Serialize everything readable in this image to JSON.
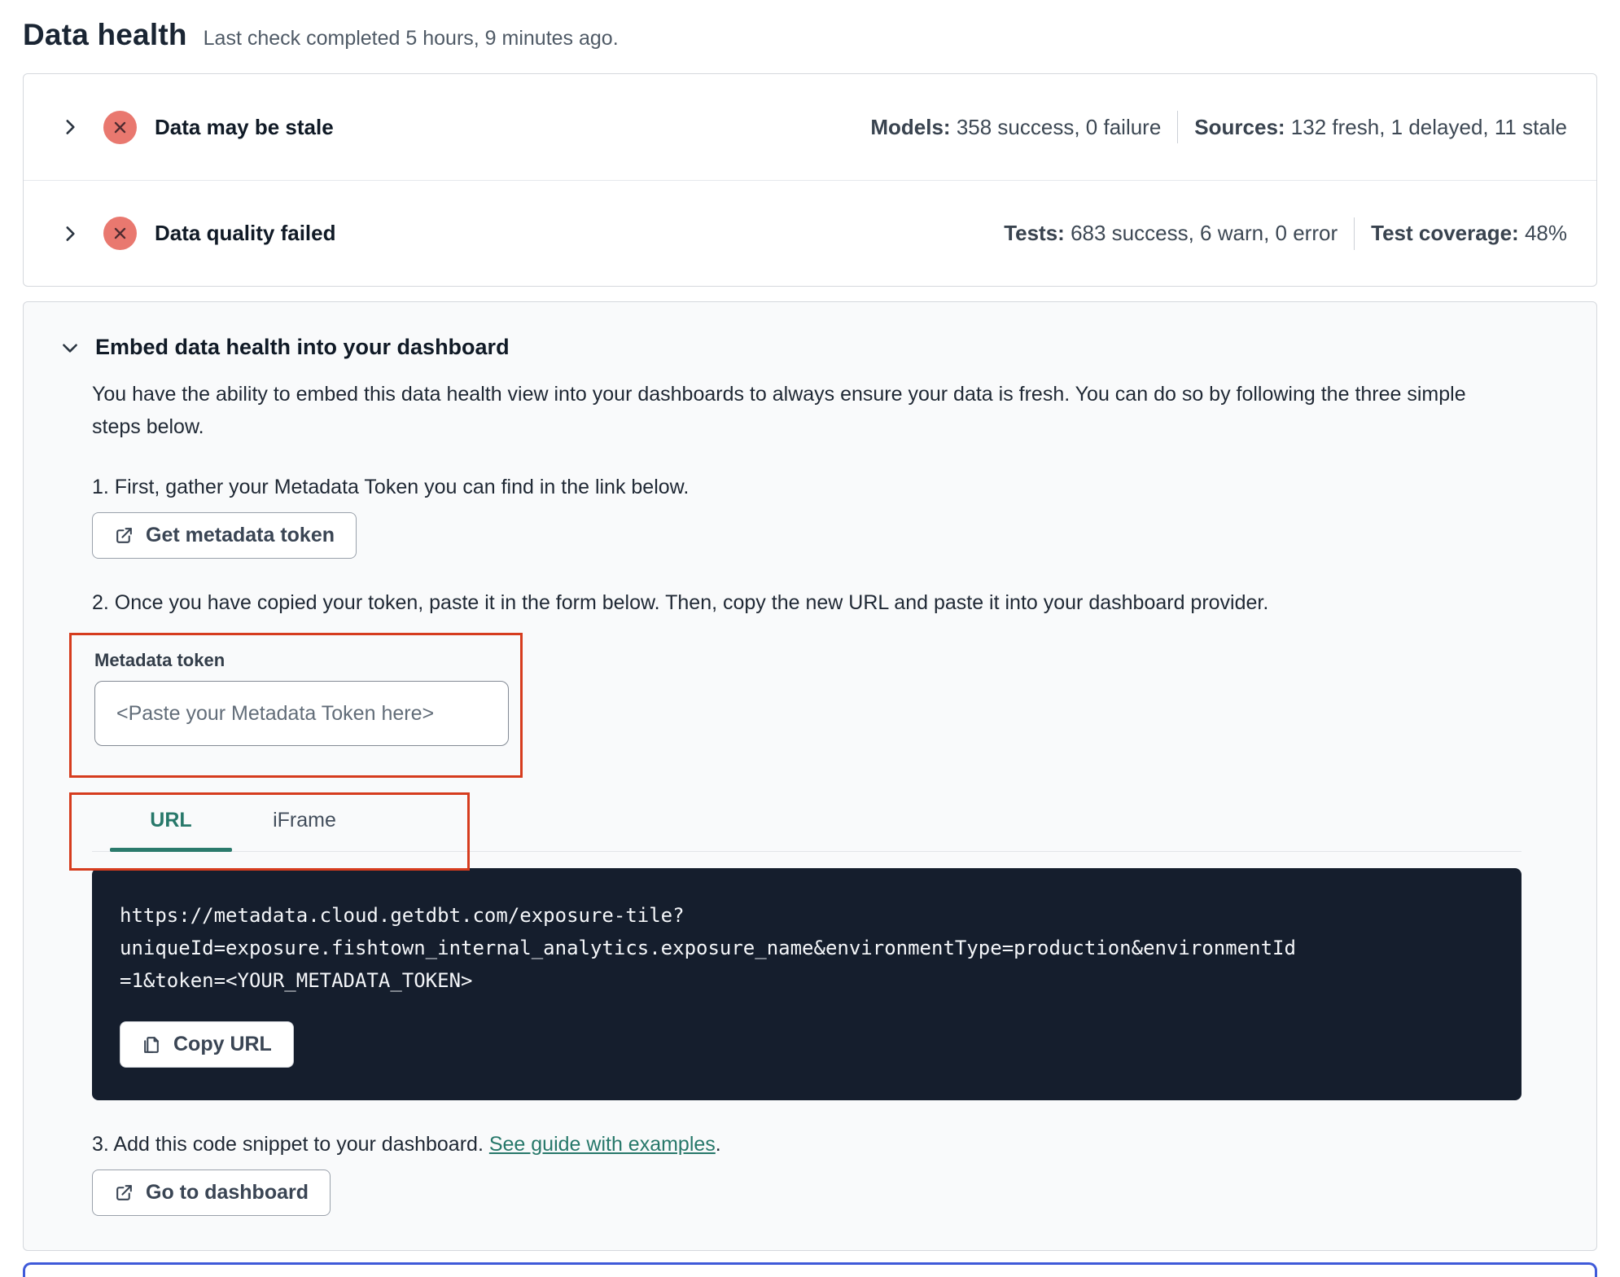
{
  "header": {
    "title": "Data health",
    "subtitle": "Last check completed 5 hours, 9 minutes ago."
  },
  "status_rows": [
    {
      "title": "Data may be stale",
      "icon": "error-x-circle",
      "stats": [
        {
          "label": "Models:",
          "value": "358 success, 0 failure"
        },
        {
          "label": "Sources:",
          "value": "132 fresh, 1 delayed, 11 stale"
        }
      ]
    },
    {
      "title": "Data quality failed",
      "icon": "error-x-circle",
      "stats": [
        {
          "label": "Tests:",
          "value": "683 success, 6 warn, 0 error"
        },
        {
          "label": "Test coverage:",
          "value": "48%"
        }
      ]
    }
  ],
  "embed": {
    "title": "Embed data health into your dashboard",
    "description": "You have the ability to embed this data health view into your dashboards to always ensure your data is fresh. You can do so by following the three simple steps below.",
    "step1": "1. First, gather your Metadata Token you can find in the link below.",
    "get_token_button": "Get metadata token",
    "step2": "2. Once you have copied your token, paste it in the form below. Then, copy the new URL and paste it into your dashboard provider.",
    "token_field": {
      "label": "Metadata token",
      "placeholder": "<Paste your Metadata Token here>",
      "value": ""
    },
    "tabs": [
      {
        "label": "URL",
        "active": true
      },
      {
        "label": "iFrame",
        "active": false
      }
    ],
    "code_lines": [
      "https://metadata.cloud.getdbt.com/exposure-tile?",
      "uniqueId=exposure.fishtown_internal_analytics.exposure_name&environmentType=production&environmentId",
      "=1&token=<YOUR_METADATA_TOKEN>"
    ],
    "copy_button": "Copy URL",
    "step3_prefix": "3. Add this code snippet to your dashboard. ",
    "step3_link": "See guide with examples",
    "step3_suffix": ".",
    "dashboard_button": "Go to dashboard"
  },
  "colors": {
    "accent_teal": "#27786a",
    "error_red": "#e9786f",
    "annotation_red": "#d63c1e",
    "code_background": "#151e2d",
    "focus_blue": "#3f5ad9"
  }
}
